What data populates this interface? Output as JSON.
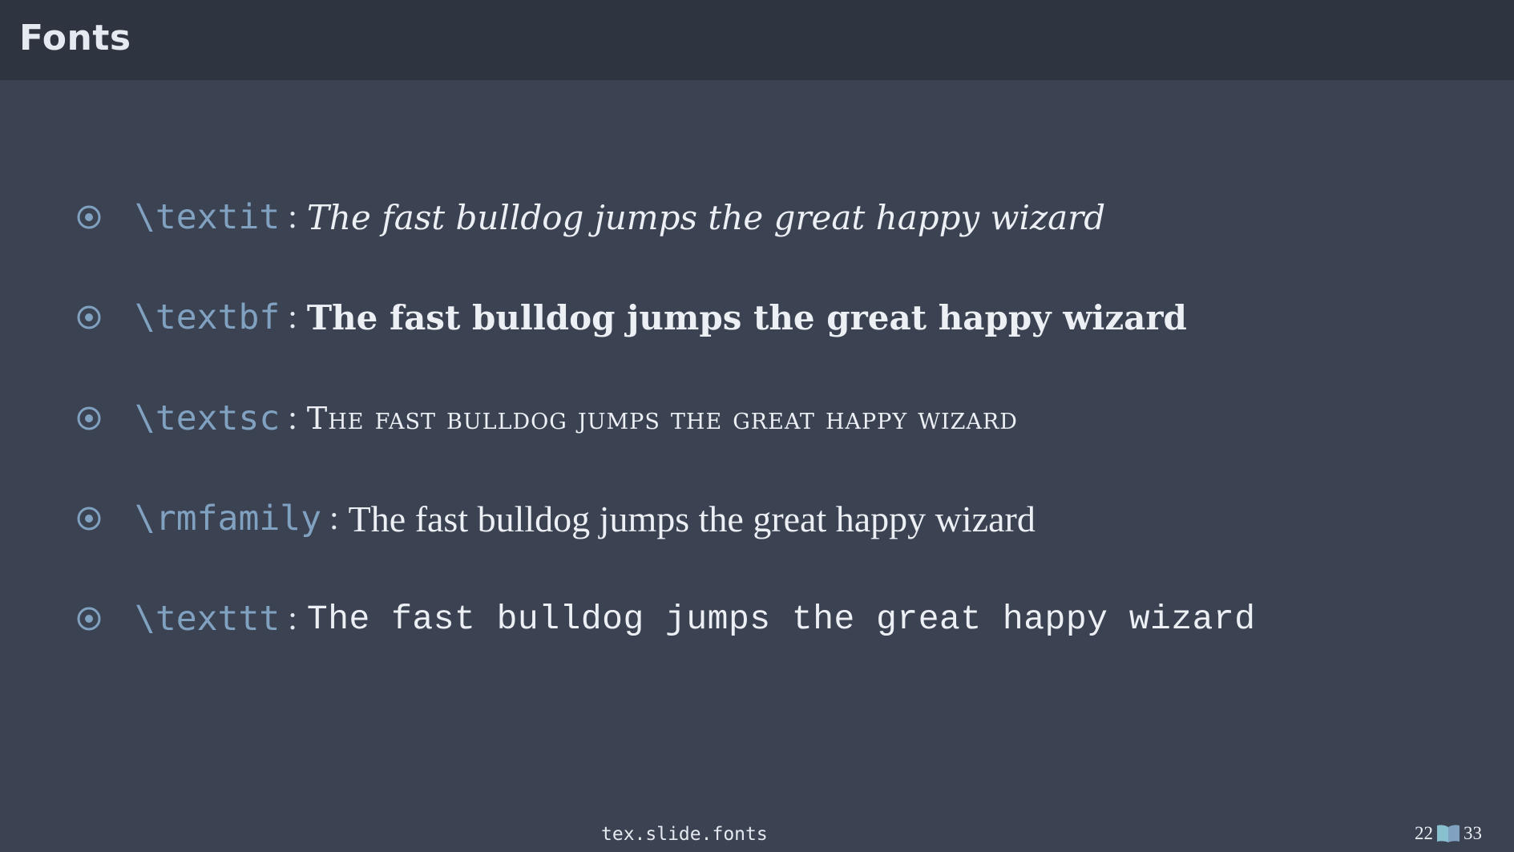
{
  "slide": {
    "title": "Fonts",
    "items": [
      {
        "command": "\\textit",
        "separator": ":",
        "sample": "The fast bulldog jumps the great happy wizard",
        "style": "italic"
      },
      {
        "command": "\\textbf",
        "separator": ":",
        "sample": "The fast bulldog jumps the great happy wizard",
        "style": "bold"
      },
      {
        "command": "\\textsc",
        "separator": ":",
        "sample": "The fast bulldog jumps the great happy wizard",
        "style": "small-caps"
      },
      {
        "command": "\\rmfamily",
        "separator": ":",
        "sample": "The fast bulldog jumps the great happy wizard",
        "style": "roman"
      },
      {
        "command": "\\texttt",
        "separator": ":",
        "sample": "The fast bulldog jumps the great happy wizard",
        "style": "typewriter"
      }
    ],
    "bullet_icon": "circled-dot-icon"
  },
  "footer": {
    "label": "tex.slide.fonts",
    "current_page": "22",
    "total_pages": "33",
    "page_icon": "book-icon"
  },
  "colors": {
    "background": "#3b4252",
    "header_background": "#2e3440",
    "command": "#81a1c1",
    "text": "#eceff4",
    "book_icon": "#88c0d0"
  }
}
